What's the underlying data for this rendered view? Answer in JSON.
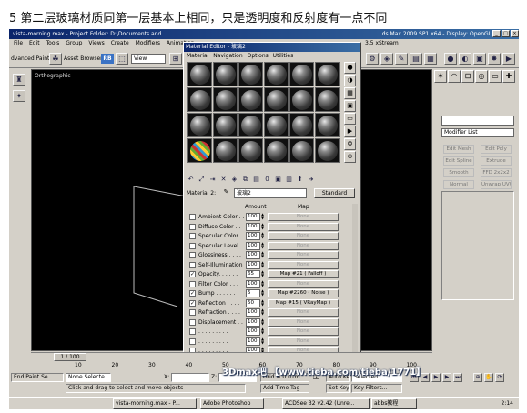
{
  "caption": "5 第二层玻璃材质同第一层基本上相同，只是透明度和反射度有一点不同",
  "main_window": {
    "title": "vista-morning.max - Project Folder: D:\\Documents and",
    "title_right": "ds Max 2009 SP1 x64 - Display: OpenGL",
    "menu": [
      "File",
      "Edit",
      "Tools",
      "Group",
      "Views",
      "Create",
      "Modifiers",
      "Animation"
    ],
    "menu_right": "3.5 xStream"
  },
  "toolbar": {
    "advanced_paint": "dvanced Paint",
    "asset_browser": "Asset Browser",
    "rb_label": "RB",
    "view_dropdown": "View"
  },
  "viewport": {
    "label": "Orthographic"
  },
  "command_panel": {
    "modifier_list": "Modifier List",
    "buttons": [
      "Edit Mesh",
      "Edit Poly",
      "Edit Spline",
      "Extrude",
      "Smooth",
      "FFD 2x2x2",
      "Normal",
      "Unwrap UVW"
    ]
  },
  "material_editor": {
    "title": "Material Editor - 玻璃2",
    "menu": [
      "Material",
      "Navigation",
      "Options",
      "Utilities"
    ],
    "material_label": "Material 2:",
    "material_name": "玻璃2",
    "type_button": "Standard",
    "columns": {
      "amount": "Amount",
      "map": "Map"
    },
    "maps": [
      {
        "name": "Ambient Color . .",
        "amount": "100",
        "map": "None",
        "checked": false
      },
      {
        "name": "Diffuse Color . .",
        "amount": "100",
        "map": "None",
        "checked": false
      },
      {
        "name": "Specular Color",
        "amount": "100",
        "map": "None",
        "checked": false
      },
      {
        "name": "Specular Level",
        "amount": "100",
        "map": "None",
        "checked": false
      },
      {
        "name": "Glossiness . . . .",
        "amount": "100",
        "map": "None",
        "checked": false
      },
      {
        "name": "Self-Illumination",
        "amount": "100",
        "map": "None",
        "checked": false
      },
      {
        "name": "Opacity. . . . . .",
        "amount": "65",
        "map": "Map #21  ( Falloff )",
        "checked": true
      },
      {
        "name": "Filter Color . . .",
        "amount": "100",
        "map": "None",
        "checked": false
      },
      {
        "name": "Bump . . . . . . .",
        "amount": "5",
        "map": "Map #2260  ( Noise )",
        "checked": true
      },
      {
        "name": "Reflection . . . .",
        "amount": "50",
        "map": "Map #15  ( VRayMap )",
        "checked": true
      },
      {
        "name": "Refraction . . . .",
        "amount": "100",
        "map": "None",
        "checked": false
      },
      {
        "name": "Displacement . .",
        "amount": "100",
        "map": "None",
        "checked": false
      },
      {
        "name": ". . . . . . . . .",
        "amount": "100",
        "map": "None",
        "checked": false
      },
      {
        "name": ". . . . . . . . .",
        "amount": "100",
        "map": "None",
        "checked": false
      },
      {
        "name": ". . . . . . . . .",
        "amount": "100",
        "map": "None",
        "checked": false
      }
    ]
  },
  "timeline": {
    "frame": "1 / 100",
    "ticks": [
      "10",
      "20",
      "30",
      "40",
      "50",
      "60",
      "70",
      "80",
      "90",
      "100"
    ]
  },
  "status_bar": {
    "end_paint": "End Paint Se",
    "selection": "None Selecte",
    "x": "X:",
    "z": "Z:",
    "grid": "Grid = 0.01m",
    "auto_key": "Auto Key",
    "selected": "Selected",
    "set_key": "Set Key",
    "key_filters": "Key Filters...",
    "add_time_tag": "Add Time Tag",
    "hint": "Click and drag to select and move objects"
  },
  "taskbar": {
    "tasks": [
      "vista-morning.max - P...",
      "Adobe Photoshop",
      "ACDSee 32 v2.42 (Unre...",
      "abbs教程"
    ],
    "clock": "2:14"
  },
  "watermark": "3Dmax吧 【www.tieba.com/tieba/1771】"
}
